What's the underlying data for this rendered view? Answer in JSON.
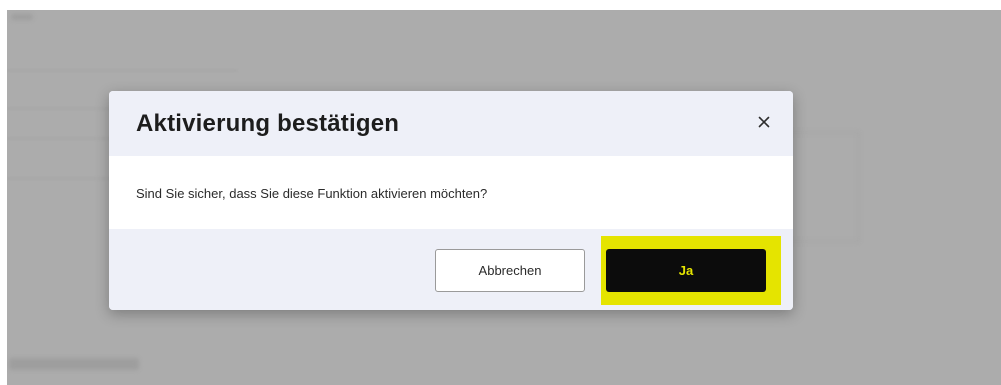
{
  "dialog": {
    "title": "Aktivierung bestätigen",
    "message": "Sind Sie sicher, dass Sie diese Funktion aktivieren möchten?",
    "close_icon": "close-icon",
    "cancel_label": "Abbrechen",
    "confirm_label": "Ja"
  },
  "colors": {
    "backdrop": "#acacac",
    "dialog_header_bg": "#eef0f8",
    "confirm_button_bg": "#0c0c0c",
    "confirm_button_text": "#e5e400",
    "highlight": "#e5e400"
  }
}
